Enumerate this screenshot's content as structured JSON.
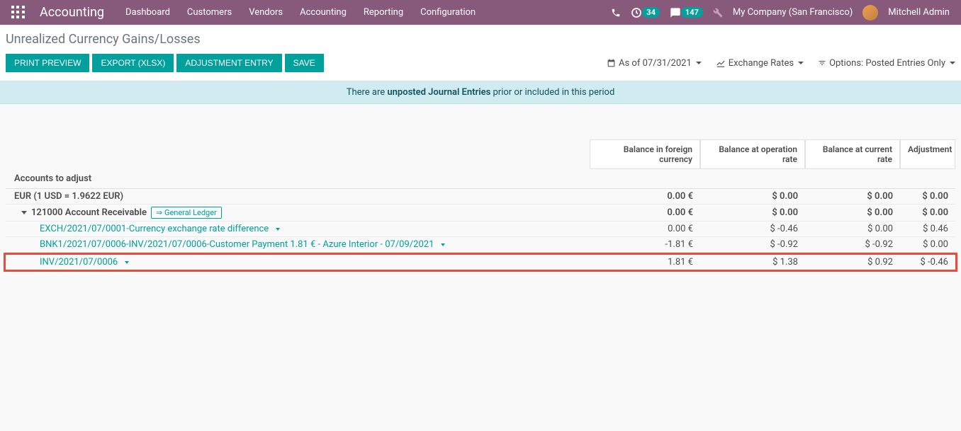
{
  "navbar": {
    "brand": "Accounting",
    "menu": [
      "Dashboard",
      "Customers",
      "Vendors",
      "Accounting",
      "Reporting",
      "Configuration"
    ],
    "badge1": "34",
    "badge2": "147",
    "company": "My Company (San Francisco)",
    "user": "Mitchell Admin"
  },
  "header": {
    "title": "Unrealized Currency Gains/Losses",
    "buttons": {
      "print": "PRINT PREVIEW",
      "export": "EXPORT (XLSX)",
      "adjustment": "ADJUSTMENT ENTRY",
      "save": "SAVE"
    },
    "filters": {
      "date": "As of 07/31/2021",
      "rates": "Exchange Rates",
      "options": "Options: Posted Entries Only"
    }
  },
  "alert": {
    "pre": "There are ",
    "bold": "unposted Journal Entries",
    "post": " prior or included in this period"
  },
  "columns": {
    "c1": "Balance in foreign currency",
    "c2": "Balance at operation rate",
    "c3": "Balance at current rate",
    "c4": "Adjustment"
  },
  "section": "Accounts to adjust",
  "rows": [
    {
      "label": "EUR (1 USD = 1.9622 EUR)",
      "bold": true,
      "indent": 0,
      "v1": "0.00 €",
      "v2": "$ 0.00",
      "v3": "$ 0.00",
      "v4": "$ 0.00",
      "vbold": true
    },
    {
      "label": "121000 Account Receivable",
      "bold": true,
      "indent": 1,
      "expandable": true,
      "gl": "⇒ General Ledger",
      "v1": "0.00 €",
      "v2": "$ 0.00",
      "v3": "$ 0.00",
      "v4": "$ 0.00",
      "vbold": true
    },
    {
      "label": "EXCH/2021/07/0001-Currency exchange rate difference",
      "link": true,
      "indent": 2,
      "caret": true,
      "v1": "0.00 €",
      "v2": "$ -0.46",
      "v3": "$ 0.00",
      "v4": "$ 0.46"
    },
    {
      "label": "BNK1/2021/07/0006-INV/2021/07/0006-Customer Payment 1.81 € - Azure Interior - 07/09/2021",
      "link": true,
      "indent": 2,
      "caret": true,
      "v1": "-1.81 €",
      "v2": "$ -0.92",
      "v3": "$ -0.92",
      "v4": "$ 0.00"
    },
    {
      "label": "INV/2021/07/0006",
      "link": true,
      "indent": 2,
      "caret": true,
      "highlighted": true,
      "v1": "1.81 €",
      "v2": "$ 1.38",
      "v3": "$ 0.92",
      "v4": "$ -0.46"
    }
  ]
}
